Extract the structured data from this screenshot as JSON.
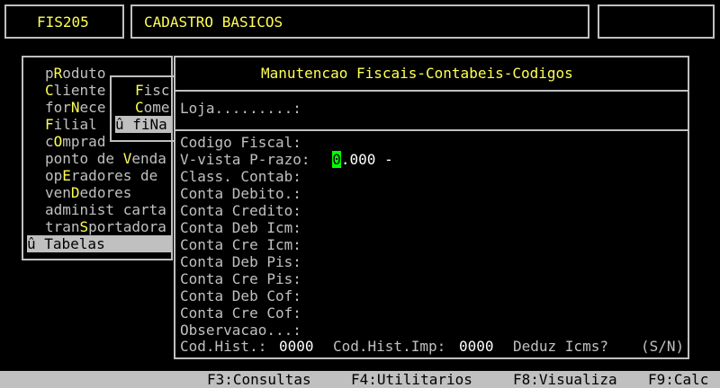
{
  "header": {
    "code": "FIS205",
    "title": "CADASTRO BASICOS",
    "right": ""
  },
  "menu": {
    "items": [
      {
        "pre": "p",
        "hot": "R",
        "post": "oduto"
      },
      {
        "pre": "",
        "hot": "C",
        "post": "liente"
      },
      {
        "pre": "for",
        "hot": "N",
        "post": "ece"
      },
      {
        "pre": "",
        "hot": "F",
        "post": "ilial"
      },
      {
        "pre": "c",
        "hot": "O",
        "post": "mprad"
      },
      {
        "pre": "ponto de ",
        "hot": "V",
        "post": "enda"
      },
      {
        "pre": "op",
        "hot": "E",
        "post": "radores de"
      },
      {
        "pre": "ven",
        "hot": "D",
        "post": "edores"
      },
      {
        "pre": "administ carta",
        "hot": "",
        "post": ""
      },
      {
        "pre": "tran",
        "hot": "S",
        "post": "portadora"
      }
    ],
    "selected": "û Tabelas"
  },
  "submenu": {
    "items": [
      {
        "pre": "",
        "hot": "F",
        "post": "isc"
      },
      {
        "pre": "",
        "hot": "C",
        "post": "ome"
      }
    ],
    "selected": "û fiNa"
  },
  "form": {
    "title": "Manutencao Fiscais-Contabeis-Codigos",
    "loja_label": "Loja.........:",
    "codigo_fiscal_label": "Codigo Fiscal:",
    "codigo_fiscal_cursor": "0",
    "codigo_fiscal_value": ".000 -",
    "fields": [
      "V-vista P-razo:",
      "Class. Contab:",
      "Conta Debito.:",
      "Conta Credito:",
      "Conta Deb Icm:",
      "Conta Cre Icm:",
      "Conta Deb Pis:",
      "Conta Cre Pis:",
      "Conta Deb Cof:",
      "Conta Cre Cof:",
      "Observacao...:"
    ],
    "cod_hist_label": "Cod.Hist.:",
    "cod_hist_value": "0000",
    "cod_hist_imp_label": "Cod.Hist.Imp:",
    "cod_hist_imp_value": "0000",
    "deduz_label": "Deduz Icms?",
    "deduz_options": "(S/N)"
  },
  "statusbar": {
    "f3": "F3:Consultas",
    "f4": "F4:Utilitarios",
    "f8": "F8:Visualiza",
    "f9": "F9:Calc"
  }
}
